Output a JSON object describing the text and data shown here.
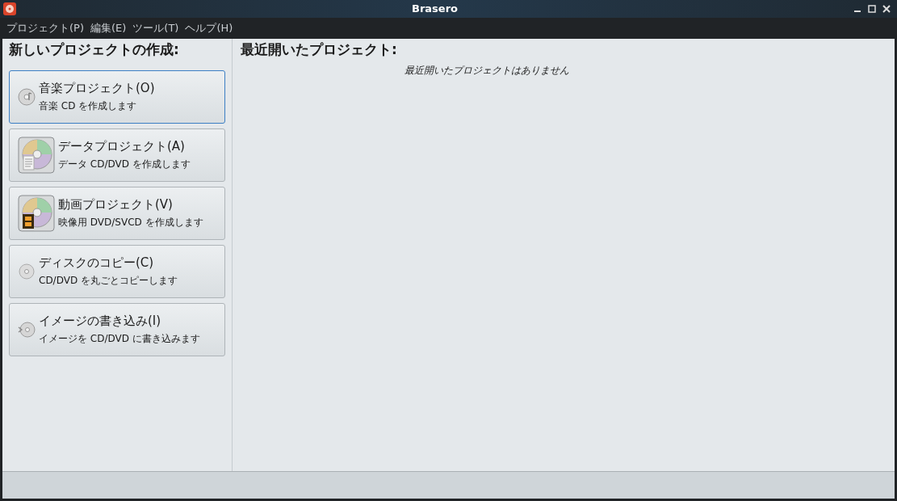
{
  "window": {
    "title": "Brasero"
  },
  "menu": [
    "プロジェクト(P)",
    "編集(E)",
    "ツール(T)",
    "ヘルプ(H)"
  ],
  "new_project": {
    "heading": "新しいプロジェクトの作成:",
    "items": [
      {
        "kind": "music",
        "title": "音楽プロジェクト(O)",
        "subtitle": "音楽  CD を作成します",
        "selected": true
      },
      {
        "kind": "data",
        "title": "データプロジェクト(A)",
        "subtitle": "データ  CD/DVD を作成します",
        "selected": false
      },
      {
        "kind": "video",
        "title": "動画プロジェクト(V)",
        "subtitle": "映像用  DVD/SVCD を作成します",
        "selected": false
      },
      {
        "kind": "copy",
        "title": "ディスクのコピー(C)",
        "subtitle": "CD/DVD を丸ごとコピーします",
        "selected": false
      },
      {
        "kind": "burn",
        "title": "イメージの書き込み(I)",
        "subtitle": "イメージを  CD/DVD に書き込みます",
        "selected": false
      }
    ]
  },
  "recent": {
    "heading": "最近開いたプロジェクト:",
    "empty_message": "最近開いたプロジェクトはありません"
  }
}
